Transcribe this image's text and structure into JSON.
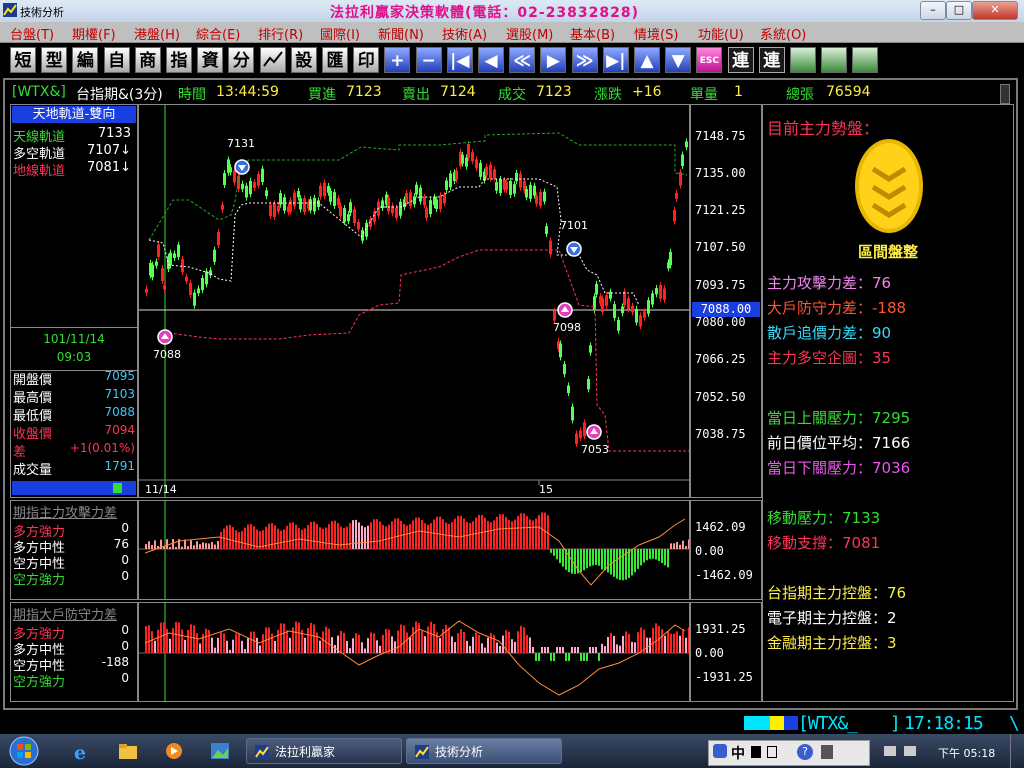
{
  "window": {
    "title": "技術分析",
    "brand": "法拉利贏家決策軟體(電話：02-23832828)",
    "minimize": "–",
    "maximize": "□",
    "close": "✕"
  },
  "menu": [
    "台盤(T)",
    "期權(F)",
    "港盤(H)",
    "綜合(E)",
    "排行(R)",
    "國際(I)",
    "新聞(N)",
    "技術(A)",
    "選股(M)",
    "基本(B)",
    "情境(S)",
    "功能(U)",
    "系統(O)"
  ],
  "toolbar": [
    "短",
    "型",
    "編",
    "自",
    "商",
    "指",
    "資",
    "分",
    "",
    "設",
    "匯",
    "印",
    "+",
    "−",
    "|◀",
    "◀",
    "≪",
    "▶",
    "≫",
    "▶|",
    "▲",
    "▼",
    "ESC",
    "連",
    "連",
    "",
    "",
    ""
  ],
  "quote": {
    "symbol": "[WTX&]",
    "name": "台指期&(3分)",
    "time_label": "時間",
    "time": "13:44:59",
    "bid_label": "買進",
    "bid": "7123",
    "ask_label": "賣出",
    "ask": "7124",
    "deal_label": "成交",
    "deal": "7123",
    "change_label": "漲跌",
    "change": "+16",
    "vol_label": "單量",
    "vol": "1",
    "total_label": "總張",
    "total": "76594"
  },
  "left": {
    "header": "天地軌道-雙向",
    "tracks": [
      {
        "label": "天線軌道",
        "value": "7133",
        "color": "#33dd33"
      },
      {
        "label": "多空軌道",
        "value": "7107↓",
        "color": "#ffffff"
      },
      {
        "label": "地線軌道",
        "value": "7081↓",
        "color": "#ff3355"
      }
    ],
    "date": "101/11/14",
    "clock": "09:03",
    "stats": [
      {
        "label": "開盤價",
        "value": "7095",
        "lc": "#ffffff",
        "vc": "#33ccff"
      },
      {
        "label": "最高價",
        "value": "7103",
        "lc": "#ffffff",
        "vc": "#33ccff"
      },
      {
        "label": "最低價",
        "value": "7088",
        "lc": "#ffffff",
        "vc": "#33ccff"
      },
      {
        "label": "收盤價",
        "value": "7094",
        "lc": "#ff3355",
        "vc": "#ff3355"
      },
      {
        "label": "差",
        "value": "+1(0.01%)",
        "lc": "#ff3355",
        "vc": "#ff3355"
      },
      {
        "label": "成交量",
        "value": "1791",
        "lc": "#ffffff",
        "vc": "#33ccff"
      }
    ]
  },
  "axis": [
    "7148.75",
    "7135.00",
    "7121.25",
    "7107.50",
    "7093.75",
    "7080.00",
    "7066.25",
    "7052.50",
    "7038.75"
  ],
  "current_price": "7088.00",
  "xlabels": [
    "11/14",
    "15"
  ],
  "markers": [
    "7131",
    "7101",
    "7088",
    "7098",
    "7053"
  ],
  "right": {
    "title": "目前主力勢盤：",
    "status": "區間盤整",
    "metrics": [
      {
        "text": "主力攻擊力差：76",
        "color": "#ee88ee"
      },
      {
        "text": "大戶防守力差：-188",
        "color": "#ff5533"
      },
      {
        "text": "散戶追價力差：90",
        "color": "#33ddff"
      },
      {
        "text": "主力多空企圖：35",
        "color": "#ff3355"
      },
      {
        "text": "當日上關壓力：7295",
        "color": "#33dd33"
      },
      {
        "text": "前日價位平均：7166",
        "color": "#ffffff"
      },
      {
        "text": "當日下關壓力：7036",
        "color": "#ee55ee"
      },
      {
        "text": "移動壓力：7133",
        "color": "#33dd33"
      },
      {
        "text": "移動支撐：7081",
        "color": "#ff3355"
      },
      {
        "text": "台指期主力控盤：76",
        "color": "#ffee44"
      },
      {
        "text": "電子期主力控盤：2",
        "color": "#ffffff"
      },
      {
        "text": "金融期主力控盤：3",
        "color": "#ffee44"
      }
    ]
  },
  "sub1": {
    "title": "期指主力攻擊力差",
    "rows": [
      {
        "label": "多方強力",
        "value": "0",
        "color": "#ff3355"
      },
      {
        "label": "多方中性",
        "value": "76",
        "color": "#ffffff"
      },
      {
        "label": "空方中性",
        "value": "0",
        "color": "#ffffff"
      },
      {
        "label": "空方強力",
        "value": "0",
        "color": "#33dd33"
      }
    ],
    "axis": [
      "1462.09",
      "0.00",
      "-1462.09"
    ]
  },
  "sub2": {
    "title": "期指大戶防守力差",
    "rows": [
      {
        "label": "多方強力",
        "value": "0",
        "color": "#ff3355"
      },
      {
        "label": "多方中性",
        "value": "0",
        "color": "#ffffff"
      },
      {
        "label": "空方中性",
        "value": "-188",
        "color": "#ffffff"
      },
      {
        "label": "空方強力",
        "value": "0",
        "color": "#33dd33"
      }
    ],
    "axis": [
      "1931.25",
      "0.00",
      "-1931.25"
    ]
  },
  "status": {
    "code": "[WTX&_",
    "close_bracket": "]",
    "time": "17:18:15",
    "tail": "\\"
  },
  "taskbar": {
    "items": [
      "法拉利贏家",
      "技術分析"
    ],
    "ime": "中",
    "clock": "下午 05:18"
  }
}
